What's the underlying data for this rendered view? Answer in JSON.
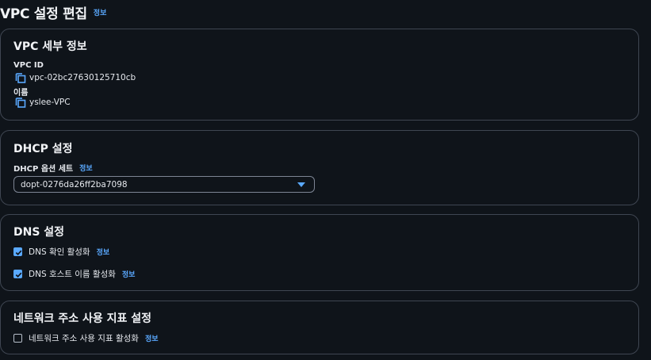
{
  "header": {
    "title": "VPC 설정 편집",
    "info": "정보"
  },
  "vpc_details": {
    "title": "VPC 세부 정보",
    "vpc_id_label": "VPC ID",
    "vpc_id_value": "vpc-02bc27630125710cb",
    "name_label": "이름",
    "name_value": "yslee-VPC"
  },
  "dhcp": {
    "title": "DHCP 설정",
    "option_set_label": "DHCP 옵션 세트",
    "info": "정보",
    "selected_value": "dopt-0276da26ff2ba7098"
  },
  "dns": {
    "title": "DNS 설정",
    "resolution_label": "DNS 확인 활성화",
    "resolution_checked": true,
    "resolution_info": "정보",
    "hostnames_label": "DNS 호스트 이름 활성화",
    "hostnames_checked": true,
    "hostnames_info": "정보"
  },
  "network_address_usage": {
    "title": "네트워크 주소 사용 지표 설정",
    "enable_label": "네트워크 주소 사용 지표 활성화",
    "enable_checked": false,
    "info": "정보"
  },
  "colors": {
    "accent": "#5aa9ff",
    "background": "#0f141a",
    "border": "#3f4652"
  },
  "icons": [
    "copy-icon",
    "caret-down-icon",
    "checkmark-icon"
  ]
}
